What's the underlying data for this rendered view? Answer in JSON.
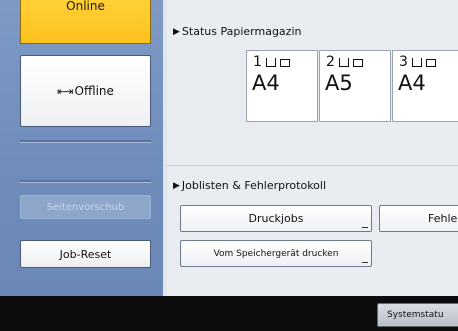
{
  "left": {
    "online_label": "Online",
    "offline_label": "Offline",
    "offline_icon": "⇤⇥",
    "seitenvorschub_label": "Seitenvorschub",
    "job_reset_label": "Job-Reset"
  },
  "paper_status": {
    "heading": "Status Papiermagazin",
    "trays": [
      {
        "number": "1",
        "size": "A4"
      },
      {
        "number": "2",
        "size": "A5"
      },
      {
        "number": "3",
        "size": "A4"
      }
    ]
  },
  "joblists": {
    "heading": "Joblisten & Fehlerprotokoll",
    "druckjobs_label": "Druckjobs",
    "fehler_label": "Fehle",
    "speicher_label": "Vom Speichergerät drucken"
  },
  "footer": {
    "systemstatus_label": "Systemstatu"
  },
  "colors": {
    "accent_yellow": "#fcc21c",
    "panel_blue": "#7290be",
    "main_bg": "#e9ecf1"
  }
}
